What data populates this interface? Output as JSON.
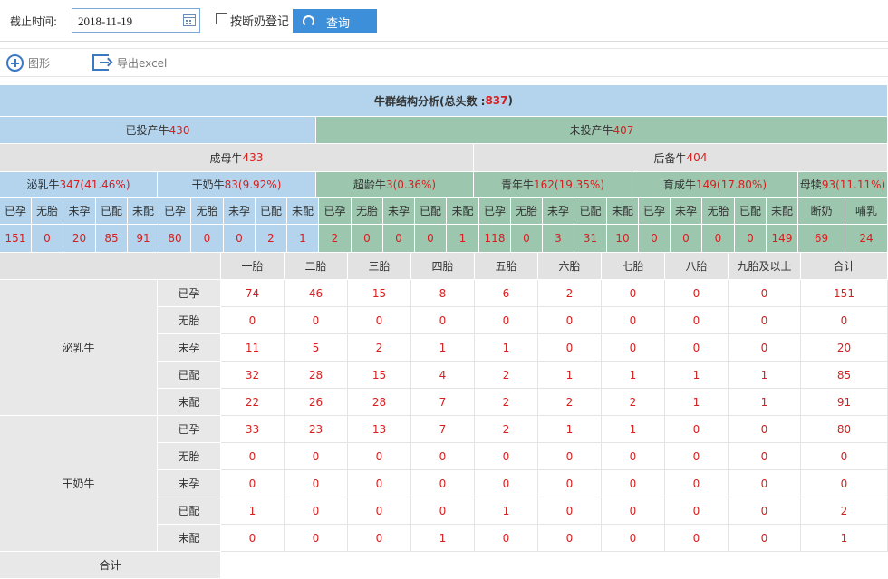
{
  "filter": {
    "date_label": "截止时间:",
    "date_value": "2018-11-19",
    "checkbox_label": "按断奶登记",
    "query_label": "查询"
  },
  "toolbar": {
    "chart_label": "图形",
    "export_label": "导出excel"
  },
  "report": {
    "title_prefix": "牛群结构分析(总头数 : ",
    "title_total": "837",
    "title_suffix": ")",
    "producing": {
      "label": "已投产牛",
      "count": "430"
    },
    "not_producing": {
      "label": "未投产牛",
      "count": "407"
    },
    "adult": {
      "label": "成母牛",
      "count": "433"
    },
    "reserve": {
      "label": "后备牛",
      "count": "404"
    },
    "groups": [
      {
        "label": "泌乳牛",
        "count": "347(41.46%)"
      },
      {
        "label": "干奶牛",
        "count": "83(9.92%)"
      },
      {
        "label": "超龄牛",
        "count": "3(0.36%)"
      },
      {
        "label": "青年牛",
        "count": "162(19.35%)"
      },
      {
        "label": "育成牛",
        "count": "149(17.80%)"
      },
      {
        "label": "母犊",
        "count": "93(11.11%)"
      }
    ],
    "sub_headers": [
      "已孕",
      "无胎",
      "未孕",
      "已配",
      "未配",
      "已孕",
      "无胎",
      "未孕",
      "已配",
      "未配",
      "已孕",
      "无胎",
      "未孕",
      "已配",
      "未配",
      "已孕",
      "无胎",
      "未孕",
      "已配",
      "未配",
      "已孕",
      "未孕",
      "无胎",
      "已配",
      "未配",
      "断奶",
      "哺乳"
    ],
    "sub_values": [
      "151",
      "0",
      "20",
      "85",
      "91",
      "80",
      "0",
      "0",
      "2",
      "1",
      "2",
      "0",
      "0",
      "0",
      "1",
      "118",
      "0",
      "3",
      "31",
      "10",
      "0",
      "0",
      "0",
      "0",
      "149",
      "69",
      "24"
    ],
    "parity_headers": [
      "一胎",
      "二胎",
      "三胎",
      "四胎",
      "五胎",
      "六胎",
      "七胎",
      "八胎",
      "九胎及以上",
      "合计"
    ],
    "sections": [
      {
        "name": "泌乳牛",
        "rows": [
          {
            "status": "已孕",
            "values": [
              "74",
              "46",
              "15",
              "8",
              "6",
              "2",
              "0",
              "0",
              "0",
              "151"
            ]
          },
          {
            "status": "无胎",
            "values": [
              "0",
              "0",
              "0",
              "0",
              "0",
              "0",
              "0",
              "0",
              "0",
              "0"
            ]
          },
          {
            "status": "未孕",
            "values": [
              "11",
              "5",
              "2",
              "1",
              "1",
              "0",
              "0",
              "0",
              "0",
              "20"
            ]
          },
          {
            "status": "已配",
            "values": [
              "32",
              "28",
              "15",
              "4",
              "2",
              "1",
              "1",
              "1",
              "1",
              "85"
            ]
          },
          {
            "status": "未配",
            "values": [
              "22",
              "26",
              "28",
              "7",
              "2",
              "2",
              "2",
              "1",
              "1",
              "91"
            ]
          }
        ]
      },
      {
        "name": "干奶牛",
        "rows": [
          {
            "status": "已孕",
            "values": [
              "33",
              "23",
              "13",
              "7",
              "2",
              "1",
              "1",
              "0",
              "0",
              "80"
            ]
          },
          {
            "status": "无胎",
            "values": [
              "0",
              "0",
              "0",
              "0",
              "0",
              "0",
              "0",
              "0",
              "0",
              "0"
            ]
          },
          {
            "status": "未孕",
            "values": [
              "0",
              "0",
              "0",
              "0",
              "0",
              "0",
              "0",
              "0",
              "0",
              "0"
            ]
          },
          {
            "status": "已配",
            "values": [
              "1",
              "0",
              "0",
              "0",
              "1",
              "0",
              "0",
              "0",
              "0",
              "2"
            ]
          },
          {
            "status": "未配",
            "values": [
              "0",
              "0",
              "0",
              "1",
              "0",
              "0",
              "0",
              "0",
              "0",
              "1"
            ]
          }
        ]
      }
    ],
    "total_label": "合计"
  }
}
